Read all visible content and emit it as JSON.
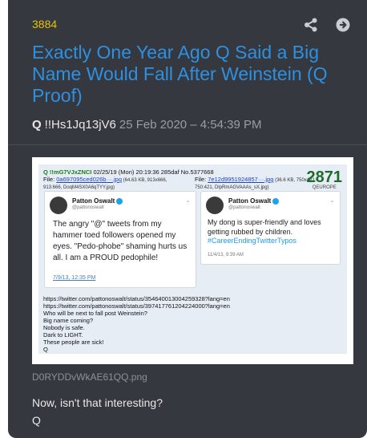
{
  "post": {
    "number": "3884",
    "title": "Exactly One Year Ago Q Said a Big Name Would Fall After Weinstein (Q Proof)",
    "author_name": "Q",
    "tripcode": "!!Hs1Jq13jV6",
    "timestamp": "25 Feb 2020 – 4:54:39 PM",
    "image_filename": "D0RYDDvWkAE61QQ.png",
    "body_lines": [
      "Now, isn't that interesting?",
      "Q"
    ]
  },
  "actions": {
    "share_icon": "share-icon",
    "open_icon": "arrow-circle-right-icon"
  },
  "colors": {
    "card_bg": "#35393f",
    "post_number": "#e5c300",
    "title": "#2f8fe0"
  },
  "screenshot": {
    "header": {
      "trip": "Q !!mG7VJxZNCI",
      "line1_rest": " 02/25/19 (Mon) 20:19:36 285daf  No.5377668",
      "file1_label": "File: ",
      "file1_link": "0a697095ced026b···.jpg",
      "file1_meta": " (64.63 KB, 913x666,",
      "file1_meta2": "913:666, DoqM4SX0A6qTYY.jpg)",
      "file2_label": "File: ",
      "file2_link": "7e12d9951924857···.jpg",
      "file2_meta": " (36.6 KB, 750x421,",
      "file2_meta2": "750:421, DlpRmAGVAAAs_sX.jpg)"
    },
    "logo": {
      "number": "2871",
      "sub": "QEUROPE"
    },
    "tweet1": {
      "name": "Patton Oswalt",
      "handle": "@pattonoswalt",
      "text": "The angry \"@\" tweets from my hammer toed followers opened my eyes. \"Pedo-phobe\" shaming hurts us all. I am a PROUD pedophile!",
      "date": "7/9/13, 12:35 PM"
    },
    "tweet2": {
      "name": "Patton Oswalt",
      "handle": "@pattonoswalt",
      "text": "My dong is super-friendly and loves getting rubbed by children.",
      "hashtag": "#CareerEndingTwitterTypos",
      "date": "11/4/13, 9:39 AM"
    },
    "q_lines": [
      "https://twitter.com/pattonoswalt/status/354640013004259328?lang=en",
      "https://twitter.com/pattonoswalt/status/397417761204224000?lang=en",
      "Who will be next to fall post Weinstein?",
      "Big name coming?",
      "Nobody is safe.",
      "Dark to LIGHT.",
      "These people are sick!",
      "Q"
    ]
  }
}
